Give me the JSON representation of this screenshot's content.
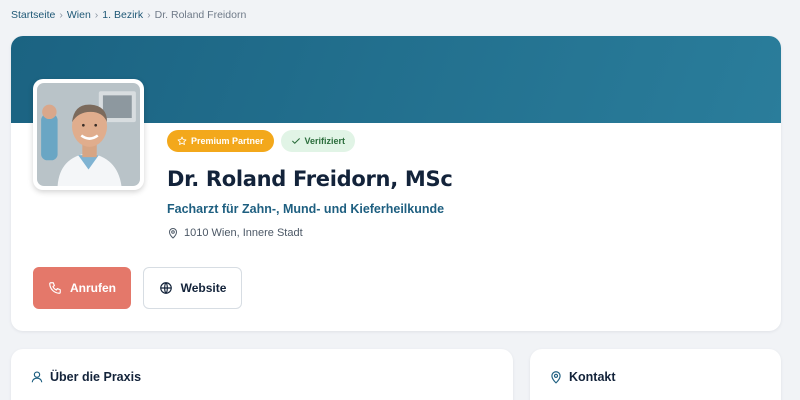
{
  "breadcrumb": {
    "items": [
      "Startseite",
      "Wien",
      "1. Bezirk"
    ],
    "separator": "›",
    "current": "Dr. Roland Freidorn"
  },
  "profile": {
    "badges": {
      "premium": "Premium Partner",
      "verified": "Verifiziert"
    },
    "name": "Dr. Roland Freidorn, MSc",
    "specialty": "Facharzt für Zahn-, Mund- und Kieferheilkunde",
    "location": "1010 Wien, Innere Stadt",
    "buttons": {
      "call": "Anrufen",
      "website": "Website"
    }
  },
  "sections": {
    "about_title": "Über die Praxis",
    "contact_title": "Kontakt"
  },
  "colors": {
    "banner": "#1b6382",
    "accent": "#1e5f80",
    "call_button": "#e4786a",
    "premium_badge": "#f3a81b",
    "verified_badge": "#e1f4e6"
  },
  "icons": {
    "premium": "star-icon",
    "verified": "check-icon",
    "location": "map-pin-icon",
    "call": "phone-icon",
    "website": "globe-icon",
    "about": "user-icon",
    "contact": "map-pin-icon"
  }
}
